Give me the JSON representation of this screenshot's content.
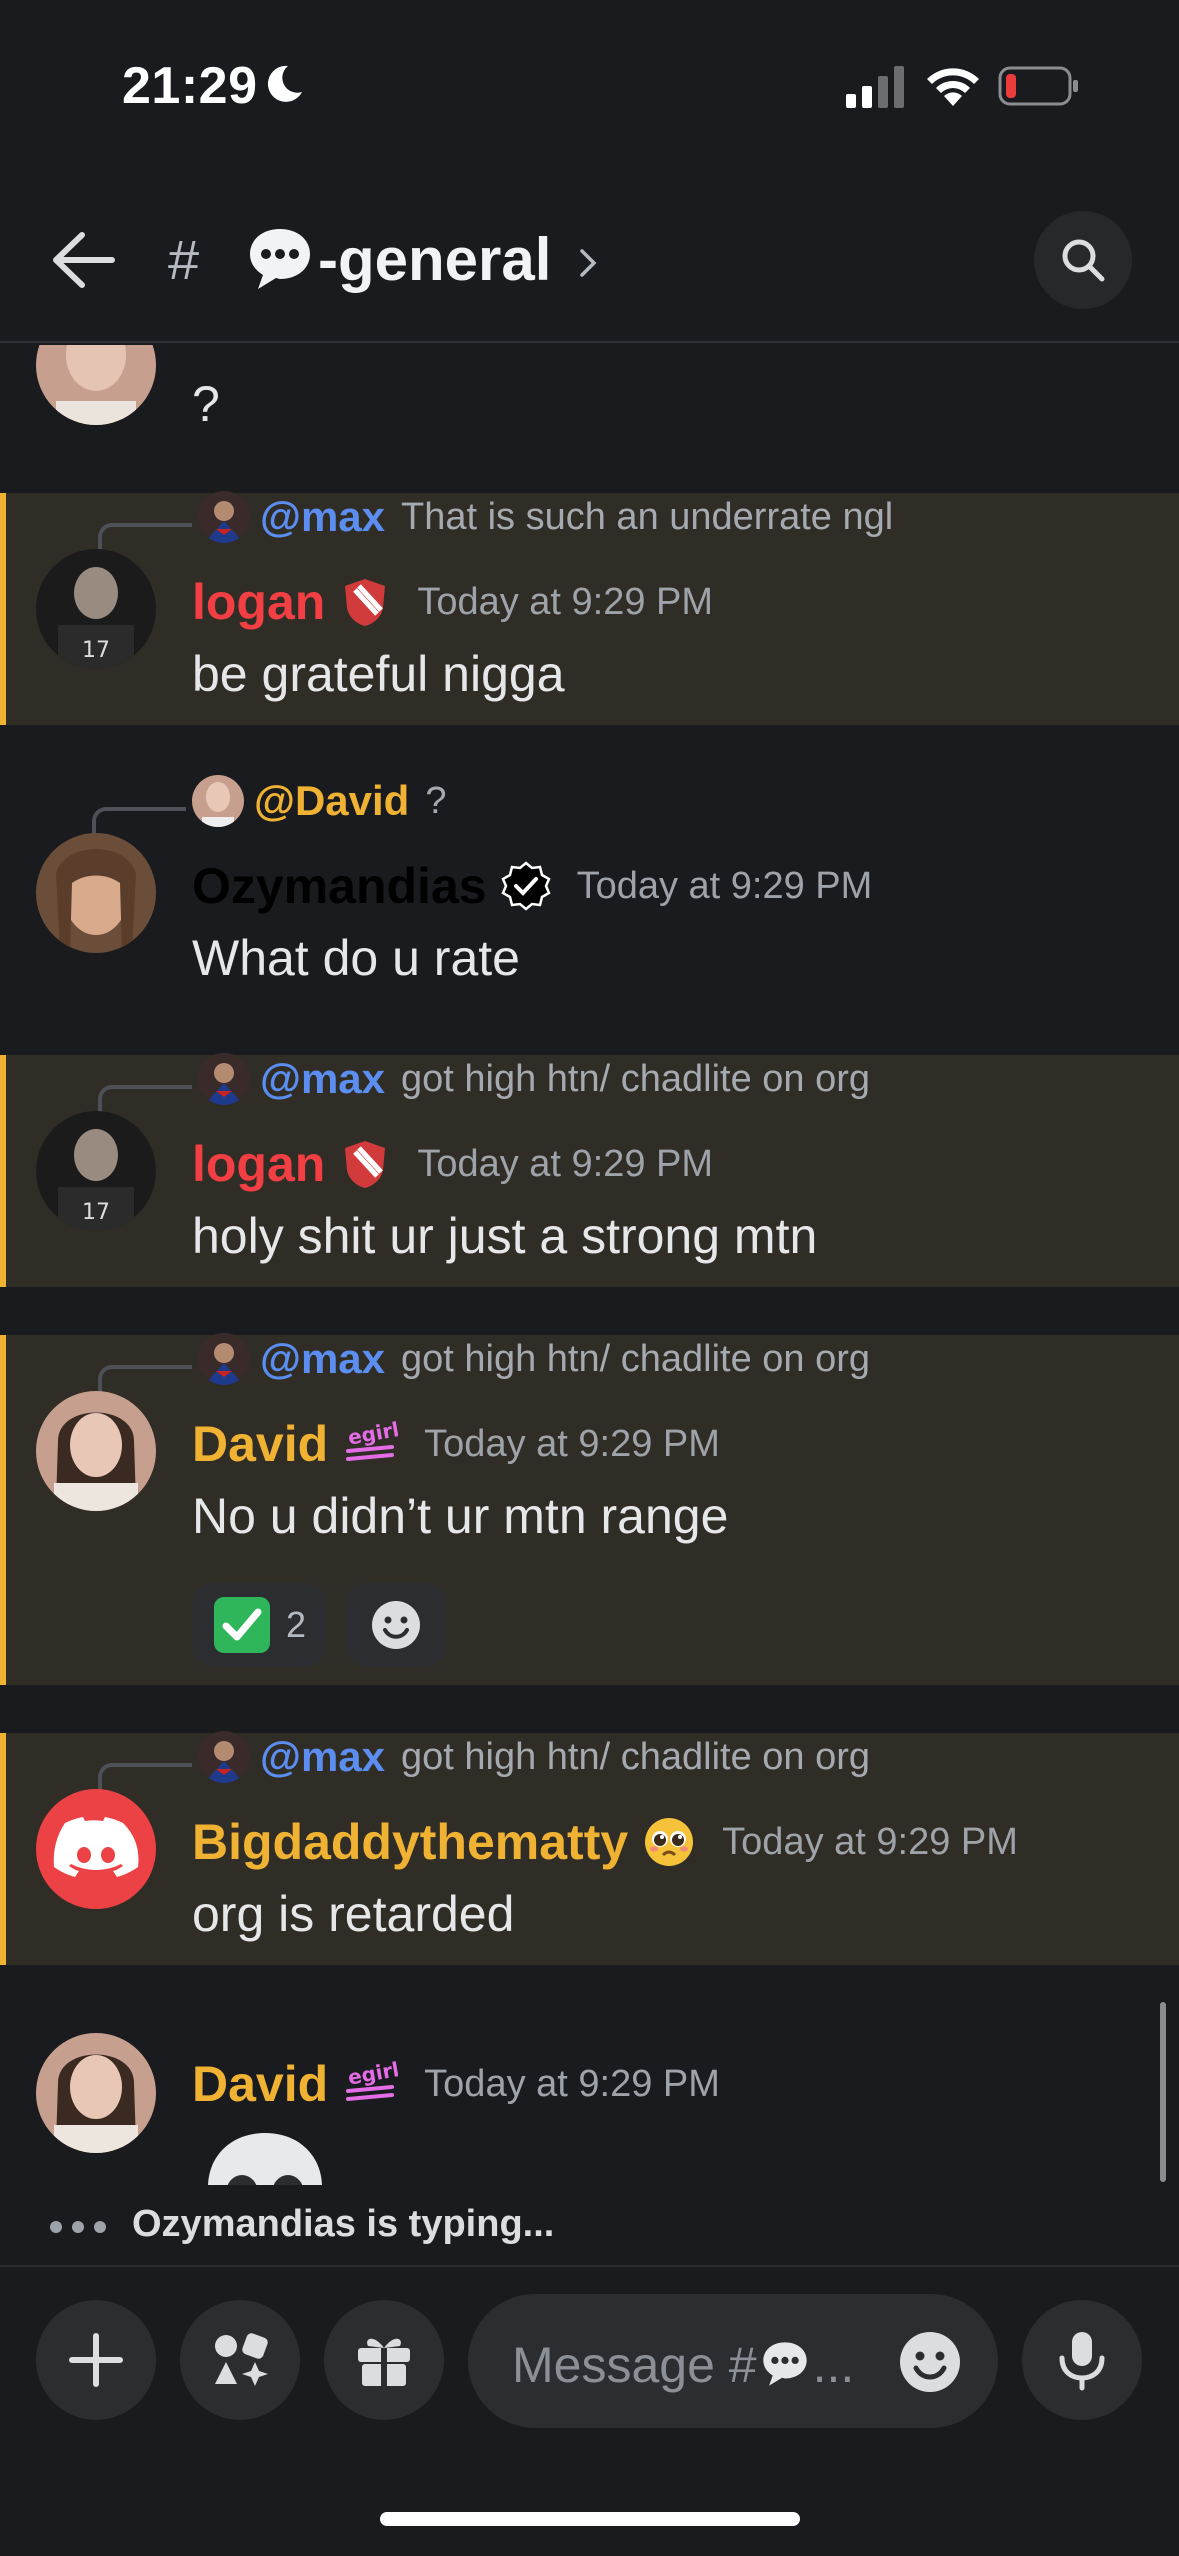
{
  "status_bar": {
    "time": "21:29"
  },
  "header": {
    "hash": "#",
    "channel_name": "-general"
  },
  "messages": [
    {
      "text": "?"
    },
    {
      "reply": {
        "name": "@max",
        "text": "That is such an underrate ngl"
      },
      "author": "logan",
      "author_color": "#f23f43",
      "timestamp": "Today at 9:29 PM",
      "text": "be grateful nigga"
    },
    {
      "reply": {
        "name": "@David",
        "text": "?"
      },
      "author": "Ozymandias",
      "author_color": "#000000",
      "timestamp": "Today at 9:29 PM",
      "text": "What do u rate"
    },
    {
      "reply": {
        "name": "@max",
        "text": "got high htn/ chadlite on org"
      },
      "author": "logan",
      "author_color": "#f23f43",
      "timestamp": "Today at 9:29 PM",
      "text": "holy shit ur just a strong mtn"
    },
    {
      "reply": {
        "name": "@max",
        "text": "got high htn/ chadlite on org"
      },
      "author": "David",
      "author_color": "#f0b232",
      "timestamp": "Today at 9:29 PM",
      "text": "No u didn’t ur mtn range",
      "reaction": {
        "emoji": "check-mark-button",
        "count": "2"
      }
    },
    {
      "reply": {
        "name": "@max",
        "text": "got high htn/ chadlite on org"
      },
      "author": "Bigdaddythematty",
      "author_color": "#f0b232",
      "timestamp": "Today at 9:29 PM",
      "text": "org is retarded"
    },
    {
      "author": "David",
      "author_color": "#f0b232",
      "timestamp": "Today at 9:29 PM"
    }
  ],
  "badges": {
    "egirl_label": "egirl"
  },
  "typing": {
    "text": "Ozymandias is typing..."
  },
  "composer": {
    "placeholder": "Message #",
    "placeholder_suffix": "..."
  },
  "colors": {
    "mention_bg": "#302d26",
    "mention_bar": "#f0b232",
    "link_blue": "#5b8ef0"
  }
}
